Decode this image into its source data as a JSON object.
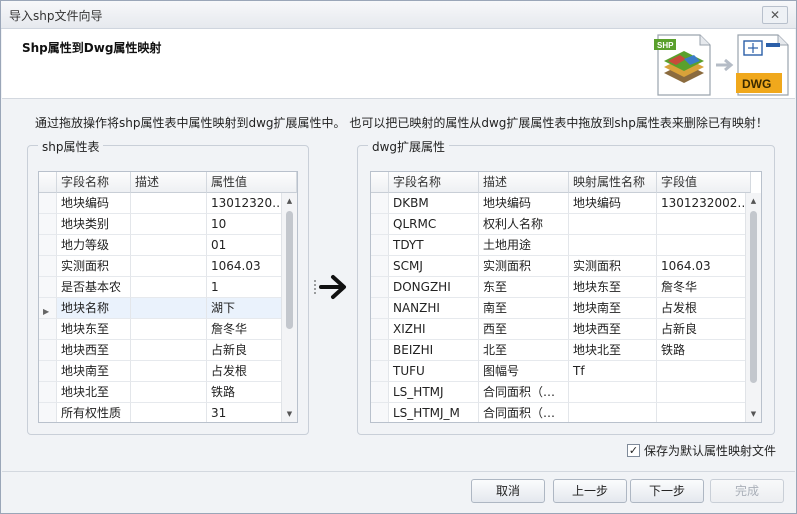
{
  "window": {
    "title": "导入shp文件向导",
    "close_glyph": "✕"
  },
  "header": {
    "title": "Shp属性到Dwg属性映射",
    "shp_label": "SHP",
    "dwg_label": "DWG"
  },
  "instruction": "通过拖放操作将shp属性表中属性映射到dwg扩展属性中。 也可以把已映射的属性从dwg扩展属性表中拖放到shp属性表来删除已有映射！",
  "shp_table": {
    "group_label": "shp属性表",
    "columns": [
      "字段名称",
      "描述",
      "属性值"
    ],
    "rows": [
      [
        "地块编码",
        "",
        "13012320…"
      ],
      [
        "地块类别",
        "",
        "10"
      ],
      [
        "地力等级",
        "",
        "01"
      ],
      [
        "实测面积",
        "",
        "1064.03"
      ],
      [
        "是否基本农",
        "",
        "1"
      ],
      [
        "地块名称",
        "",
        "湖下"
      ],
      [
        "地块东至",
        "",
        "詹冬华"
      ],
      [
        "地块西至",
        "",
        "占新良"
      ],
      [
        "地块南至",
        "",
        "占发根"
      ],
      [
        "地块北至",
        "",
        "铁路"
      ],
      [
        "所有权性质",
        "",
        "31"
      ]
    ],
    "selected_row_marker": "▶"
  },
  "dwg_table": {
    "group_label": "dwg扩展属性",
    "columns": [
      "字段名称",
      "描述",
      "映射属性名称",
      "字段值"
    ],
    "rows": [
      [
        "DKBM",
        "地块编码",
        "地块编码",
        "1301232002…"
      ],
      [
        "QLRMC",
        "权利人名称",
        "",
        ""
      ],
      [
        "TDYT",
        "土地用途",
        "",
        ""
      ],
      [
        "SCMJ",
        "实测面积",
        "实测面积",
        "1064.03"
      ],
      [
        "DONGZHI",
        "东至",
        "地块东至",
        "詹冬华"
      ],
      [
        "NANZHI",
        "南至",
        "地块南至",
        "占发根"
      ],
      [
        "XIZHI",
        "西至",
        "地块西至",
        "占新良"
      ],
      [
        "BEIZHI",
        "北至",
        "地块北至",
        "铁路"
      ],
      [
        "TUFU",
        "图幅号",
        "Tf",
        ""
      ],
      [
        "LS_HTMJ",
        "合同面积（…",
        "",
        ""
      ],
      [
        "LS_HTMJ_M",
        "合同面积（…",
        "",
        ""
      ]
    ]
  },
  "scroll_arrows": {
    "up": "▲",
    "down": "▼"
  },
  "checkbox": {
    "label": "保存为默认属性映射文件",
    "checked": true,
    "check_glyph": "✓"
  },
  "buttons": {
    "cancel": "取消",
    "prev": "上一步",
    "next": "下一步",
    "finish": "完成"
  }
}
